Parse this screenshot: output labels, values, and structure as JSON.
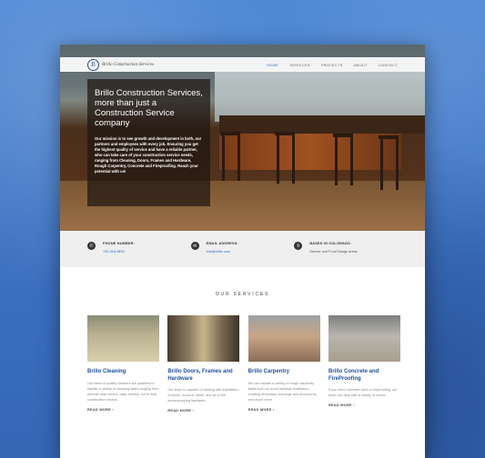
{
  "nav": {
    "logo_mark": "B",
    "logo_text": "Brillo Construction Services",
    "links": [
      "HOME",
      "SERVICES",
      "PROJECTS",
      "ABOUT",
      "CONTACT"
    ]
  },
  "hero": {
    "title": "Brillo Construction Services, more than just a Construction Service company",
    "text": "Our mission is to see growth and development in both, our partners and employees with every job. Ensuring you get the highest quality of service and have a reliable partner, who can take care of your construction service needs, ranging from Cleaning, Doors, Frames and Hardware, Rough Carpentry, Concrete and Fireproofing. Reach your potential with us!"
  },
  "info": [
    {
      "label": "PHONE NUMBER:",
      "value": "720-316-9833",
      "icon": "phone-icon"
    },
    {
      "label": "EMAIL ADDRESS:",
      "value": "info@brillo.com",
      "icon": "mail-icon"
    },
    {
      "label": "BASED IN COLORADO",
      "value": "Denver and Front Range areas",
      "icon": "location-icon"
    }
  ],
  "services": {
    "heading": "OUR SERVICES",
    "cards": [
      {
        "title": "Brillo Cleaning",
        "text": "Our team of quality cleaners are qualified to handle a variety of cleaning tasks ranging from periodic slab cleans, daily, weekly, not to final construction cleans.",
        "more": "READ MORE ›"
      },
      {
        "title": "Brillo Doors, Frames and Hardware",
        "text": "Our team is capable of dealing with installation of doors, wood or metal, and all of the accompanying hardware.",
        "more": "READ MORE ›"
      },
      {
        "title": "Brillo Carpentry",
        "text": "We can handle a variety of rough carpentry tasks such as wood backing installation, creating temporary openings and enclosures, and much more.",
        "more": "READ MORE ›"
      },
      {
        "title": "Brillo Concrete and FireProofing",
        "text": "If you need concrete work or fireproofing, our team can deal with a variety of works.",
        "more": "READ MORE ›"
      }
    ]
  }
}
